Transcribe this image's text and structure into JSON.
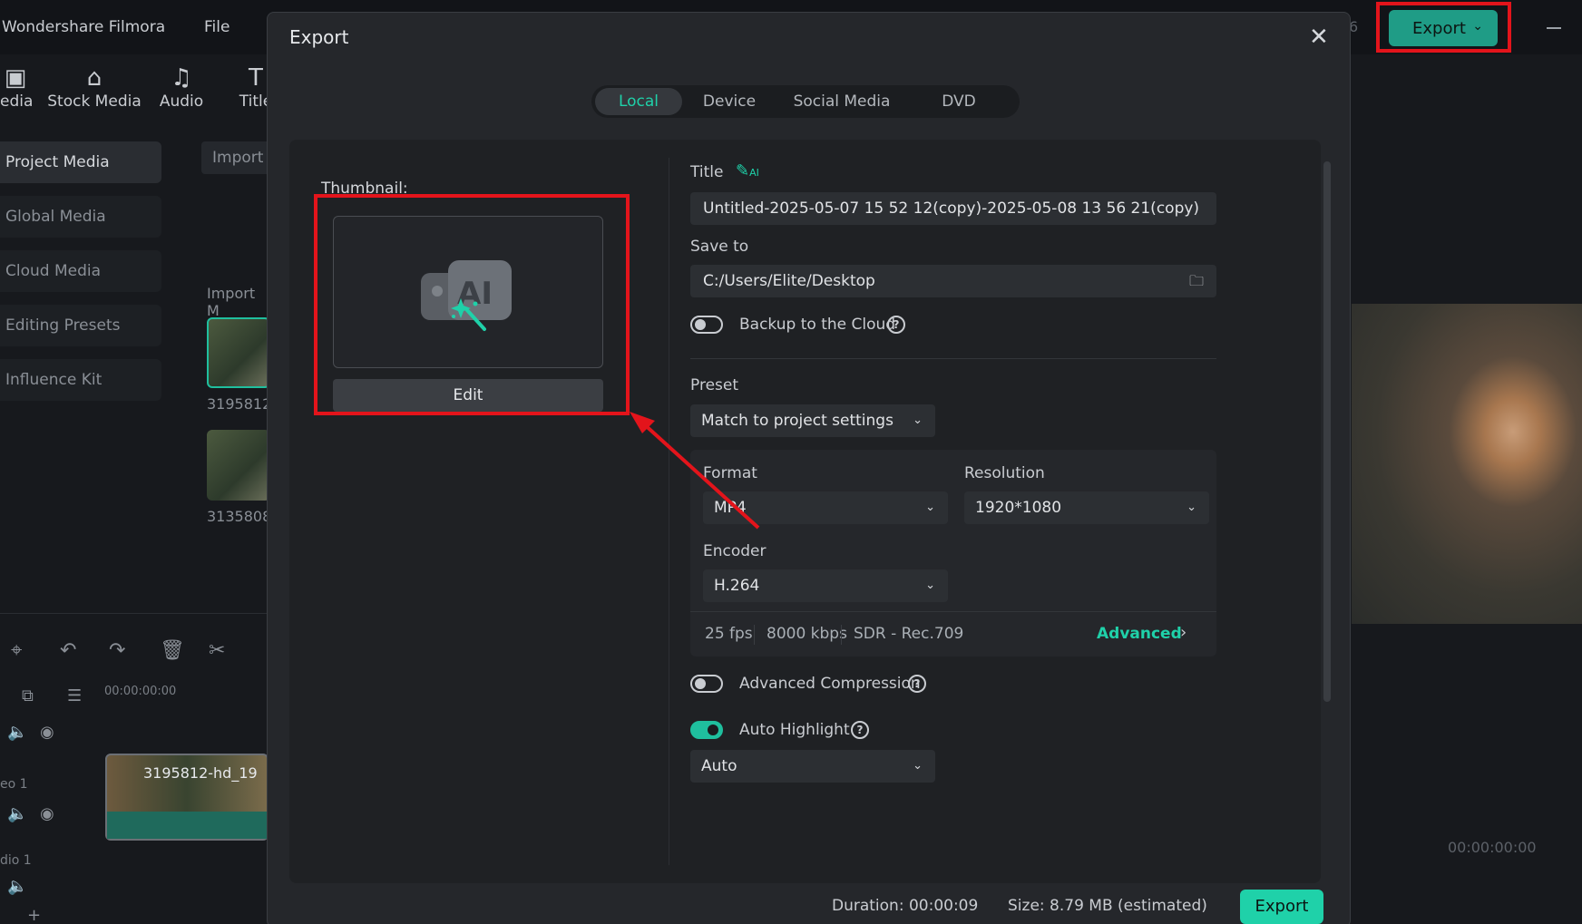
{
  "app": {
    "title": "Wondershare Filmora",
    "menu_file": "File",
    "export_button": "Export",
    "top_right_digit": "6"
  },
  "toolbar_tabs": [
    {
      "label": "edia",
      "icon": "media-icon"
    },
    {
      "label": "Stock Media",
      "icon": "store-icon"
    },
    {
      "label": "Audio",
      "icon": "music-note-icon"
    },
    {
      "label": "Title",
      "icon": "title-icon"
    }
  ],
  "left_nav": [
    {
      "label": "Project Media"
    },
    {
      "label": "Global Media"
    },
    {
      "label": "Cloud Media"
    },
    {
      "label": "Editing Presets"
    },
    {
      "label": "Influence Kit"
    }
  ],
  "media": {
    "import_label": "Import",
    "import_media_label": "Import M",
    "items": [
      "3195812",
      "3135808"
    ]
  },
  "timeline": {
    "timecode": "00:00:00:00",
    "clip_label": "3195812-hd_19",
    "video_track": "eo 1",
    "audio_track": "dio 1"
  },
  "preview": {
    "timecode": "00:00:00:00"
  },
  "dialog": {
    "title": "Export",
    "tabs": [
      "Local",
      "Device",
      "Social Media",
      "DVD"
    ],
    "active_tab": "Local",
    "thumbnail_label": "Thumbnail:",
    "edit_label": "Edit",
    "title_label": "Title",
    "title_value": "Untitled-2025-05-07 15 52 12(copy)-2025-05-08 13 56 21(copy)",
    "save_to_label": "Save to",
    "save_to_value": "C:/Users/Elite/Desktop",
    "backup_label": "Backup to the Cloud",
    "backup_on": false,
    "preset_label": "Preset",
    "preset_value": "Match to project settings",
    "format_label": "Format",
    "format_value": "MP4",
    "resolution_label": "Resolution",
    "resolution_value": "1920*1080",
    "encoder_label": "Encoder",
    "encoder_value": "H.264",
    "stats": {
      "fps": "25 fps",
      "bitrate": "8000 kbps",
      "color": "SDR - Rec.709"
    },
    "advanced_label": "Advanced",
    "adv_compression_label": "Advanced Compression",
    "adv_compression_on": false,
    "auto_highlight_label": "Auto Highlight",
    "auto_highlight_on": true,
    "auto_highlight_value": "Auto",
    "duration": "Duration: 00:00:09",
    "size": "Size:  8.79 MB (estimated)",
    "export_label": "Export"
  },
  "colors": {
    "accent": "#1fd1a9",
    "annotation_red": "#e3141b",
    "dialog_bg": "#25272b"
  }
}
